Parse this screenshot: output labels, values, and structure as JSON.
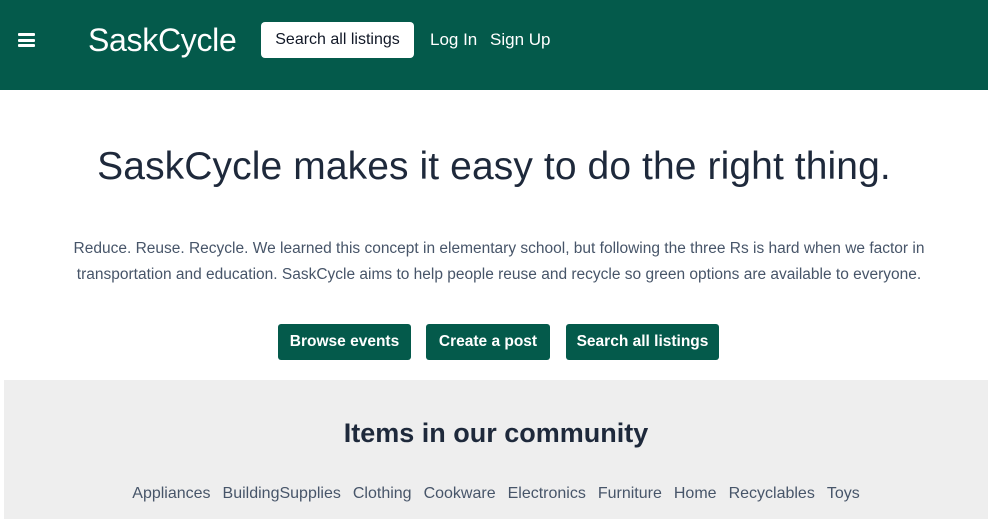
{
  "navbar": {
    "menu_icon": "hamburger-menu-icon",
    "brand": "SaskCycle",
    "search_button": "Search all listings",
    "login": "Log In",
    "signup": "Sign Up",
    "background_color": "#045a4b"
  },
  "hero": {
    "title": "SaskCycle makes it easy to do the right thing.",
    "description": "Reduce. Reuse. Recycle. We learned this concept in elementary school, but following the three Rs is hard when we factor in transportation and education. SaskCycle aims to help people reuse and recycle so green options are available to everyone.",
    "buttons": {
      "browse_events": "Browse events",
      "create_post": "Create a post",
      "search_listings": "Search all listings"
    }
  },
  "community": {
    "title": "Items in our community",
    "categories": [
      "Appliances",
      "BuildingSupplies",
      "Clothing",
      "Cookware",
      "Electronics",
      "Furniture",
      "Home",
      "Recyclables",
      "Toys"
    ]
  }
}
